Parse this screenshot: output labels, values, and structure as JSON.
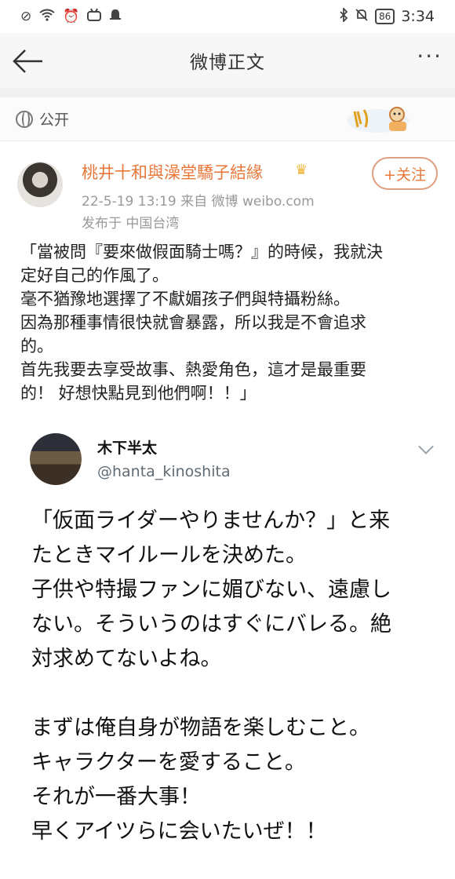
{
  "statusbar": {
    "time": "3:34",
    "battery": "86",
    "left_icons": [
      "no-sim-icon",
      "wifi-icon",
      "alarm-icon",
      "bilibili-icon",
      "notification-icon"
    ],
    "right_icons": [
      "bluetooth-icon",
      "mute-icon"
    ]
  },
  "navbar": {
    "title": "微博正文"
  },
  "visibility": {
    "label": "公开"
  },
  "post": {
    "author": "桃井十和與澡堂驕子結緣",
    "meta": "22-5-19 13:19  来自 微博 weibo.com",
    "location": "发布于 中国台湾",
    "follow_label": "+关注",
    "body_lines": [
      "「當被問『要來做假面騎士嗎？』的時候，我就決",
      "定好自己的作風了。",
      "毫不猶豫地選擇了不獻媚孩子們與特攝粉絲。",
      "因為那種事情很快就會暴露，所以我是不會追求",
      "的。",
      "首先我要去享受故事、熱愛角色，這才是最重要",
      "的！ 好想快點見到他們啊！！」"
    ]
  },
  "tweet": {
    "name": "木下半太",
    "handle": "@hanta_kinoshita",
    "body_lines": [
      "「仮面ライダーやりませんか？」と来",
      "たときマイルールを決めた。",
      "子供や特撮ファンに媚びない、遠慮し",
      "ない。そういうのはすぐにバレる。絶",
      "対求めてないよね。",
      "",
      "まずは俺自身が物語を楽しむこと。",
      "キャラクターを愛すること。",
      "それが一番大事！",
      "早くアイツらに会いたいぜ！！"
    ]
  }
}
